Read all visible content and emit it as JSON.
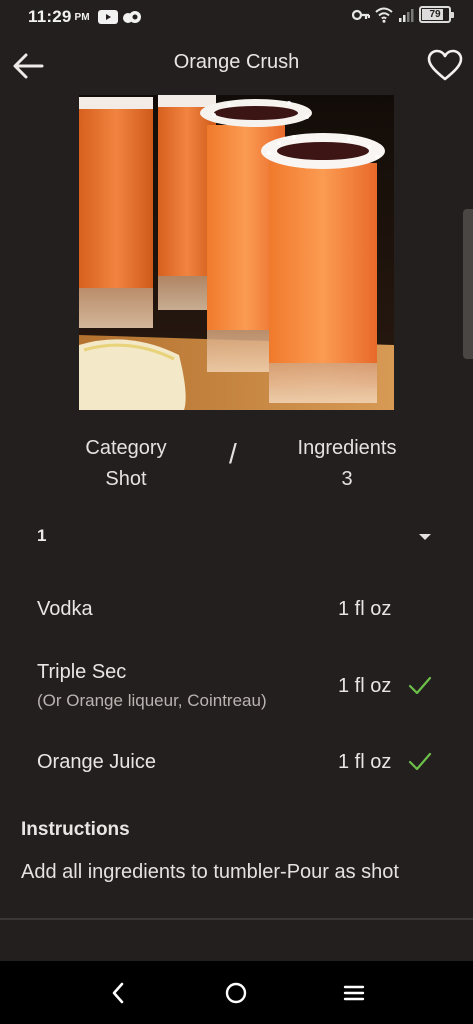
{
  "status_bar": {
    "time": "11:29",
    "ampm": "PM",
    "battery_level": "79",
    "battery_fraction": 0.79
  },
  "app_bar": {
    "title": "Orange Crush",
    "back_icon": "arrow-left-icon",
    "favorite_icon": "heart-outline-icon"
  },
  "summary": {
    "category_label": "Category",
    "category_value": "Shot",
    "separator": "/",
    "ingredients_label": "Ingredients",
    "ingredients_value": "3"
  },
  "serving": {
    "selected": "1"
  },
  "ingredients": [
    {
      "name": "Vodka",
      "note": "",
      "amount": "1 fl oz",
      "checked": false
    },
    {
      "name": "Triple Sec",
      "note": "(Or Orange liqueur, Cointreau)",
      "amount": "1 fl oz",
      "checked": true
    },
    {
      "name": "Orange Juice",
      "note": "",
      "amount": "1 fl oz",
      "checked": true
    }
  ],
  "instructions": {
    "heading": "Instructions",
    "text": "Add all ingredients to tumbler-Pour as shot"
  },
  "colors": {
    "background": "#231f1e",
    "check_green": "#6cc04a",
    "nav_bar": "#000000"
  }
}
